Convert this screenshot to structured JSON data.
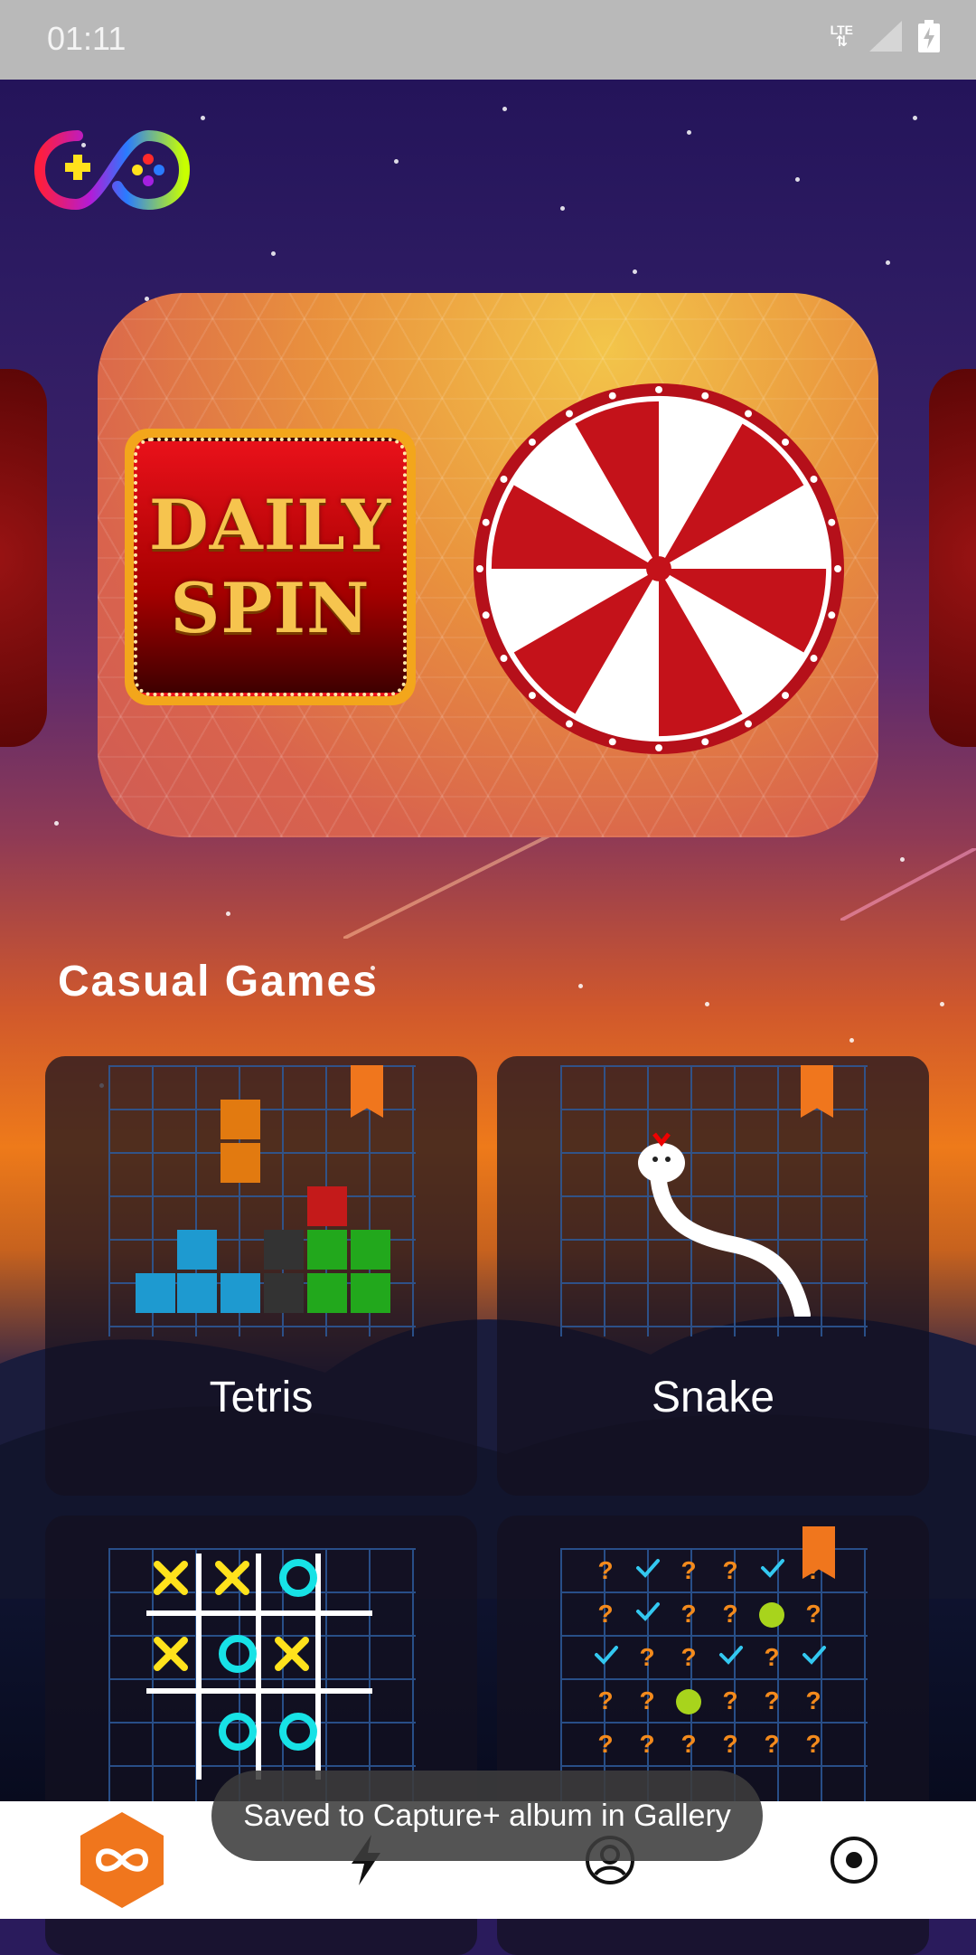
{
  "status_bar": {
    "time": "01:11",
    "icons": [
      "lte-icon",
      "signal-icon",
      "battery-icon"
    ],
    "lte_label": "LTE"
  },
  "banner": {
    "line1": "DAILY",
    "line2": "SPIN"
  },
  "section": {
    "title": "Casual Games"
  },
  "games": [
    {
      "name": "Tetris",
      "has_trophy": true
    },
    {
      "name": "Snake",
      "has_trophy": true
    },
    {
      "name": "",
      "has_trophy": false
    },
    {
      "name": "",
      "has_trophy": true
    }
  ],
  "toast": {
    "message": "Saved to Capture+ album in Gallery"
  },
  "nav": {
    "items": [
      "infinity-home-icon",
      "lightning-icon",
      "profile-icon",
      "record-icon"
    ],
    "active_color": "#f0761d"
  },
  "colors": {
    "accent": "#f0761d",
    "wheel_red": "#c4121a",
    "tetris_blue": "#1e9ad0",
    "tetris_green": "#22a81c",
    "tictac_x": "#ffe21c",
    "tictac_o": "#17e2e6",
    "checks": "#33c8f0"
  }
}
